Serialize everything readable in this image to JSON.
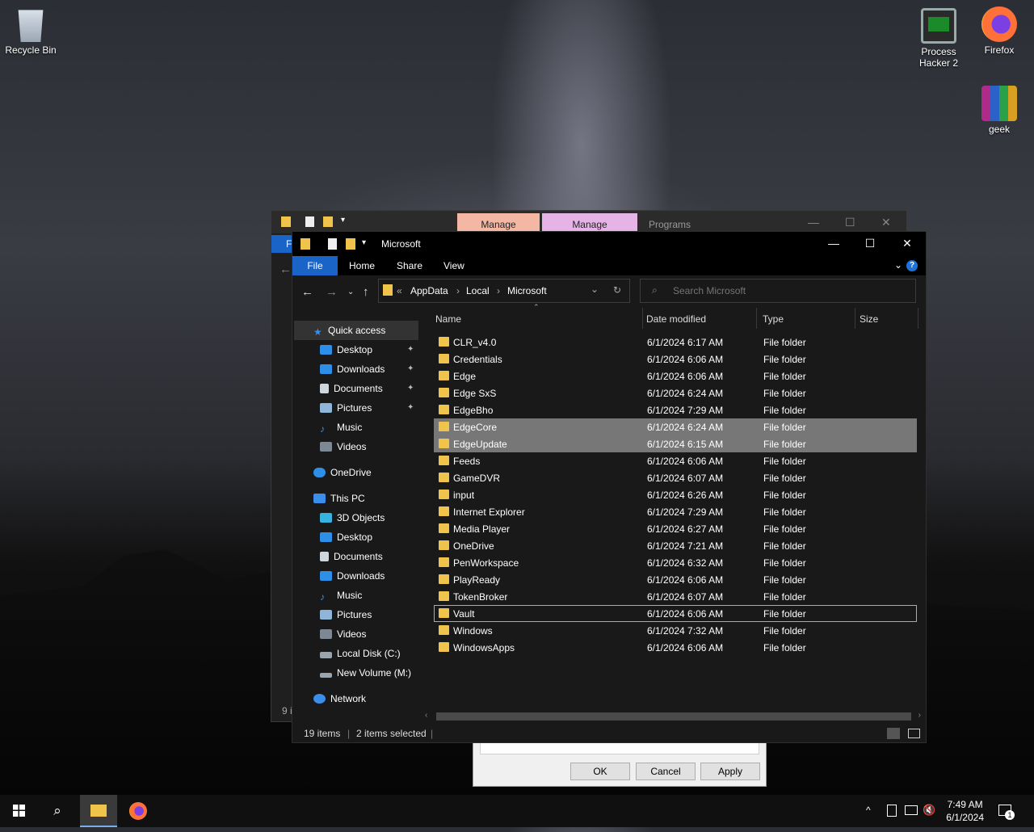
{
  "desktop": {
    "icons": [
      {
        "label": "Recycle Bin",
        "icon": "recycle-bin-icon"
      },
      {
        "label": "Process Hacker 2",
        "icon": "process-hacker-icon"
      },
      {
        "label": "Firefox",
        "icon": "firefox-icon"
      },
      {
        "label": "geek",
        "icon": "winrar-icon"
      }
    ]
  },
  "back_window": {
    "tabs": [
      "Manage",
      "Manage",
      "Programs"
    ],
    "tab_colors": [
      "#f4b7a3",
      "#e6b3e6"
    ],
    "status_fragment": "9 i",
    "file_fragment": "F"
  },
  "dialog": {
    "ok": "OK",
    "cancel": "Cancel",
    "apply": "Apply"
  },
  "explorer": {
    "title": "Microsoft",
    "ribbon": {
      "file": "File",
      "home": "Home",
      "share": "Share",
      "view": "View"
    },
    "ribbon_color": "#1a64c8",
    "address": {
      "overflow": "«",
      "crumbs": [
        "AppData",
        "Local",
        "Microsoft"
      ]
    },
    "search_placeholder": "Search Microsoft",
    "nav": {
      "quick_access": "Quick access",
      "quick_items": [
        "Desktop",
        "Downloads",
        "Documents",
        "Pictures",
        "Music",
        "Videos"
      ],
      "onedrive": "OneDrive",
      "this_pc": "This PC",
      "pc_items": [
        "3D Objects",
        "Desktop",
        "Documents",
        "Downloads",
        "Music",
        "Pictures",
        "Videos",
        "Local Disk (C:)",
        "New Volume (M:)"
      ],
      "network": "Network"
    },
    "columns": {
      "name": "Name",
      "date": "Date modified",
      "type": "Type",
      "size": "Size"
    },
    "files": [
      {
        "name": "CLR_v4.0",
        "date": "6/1/2024 6:17 AM",
        "type": "File folder"
      },
      {
        "name": "Credentials",
        "date": "6/1/2024 6:06 AM",
        "type": "File folder"
      },
      {
        "name": "Edge",
        "date": "6/1/2024 6:06 AM",
        "type": "File folder"
      },
      {
        "name": "Edge SxS",
        "date": "6/1/2024 6:24 AM",
        "type": "File folder"
      },
      {
        "name": "EdgeBho",
        "date": "6/1/2024 7:29 AM",
        "type": "File folder"
      },
      {
        "name": "EdgeCore",
        "date": "6/1/2024 6:24 AM",
        "type": "File folder",
        "selected": true
      },
      {
        "name": "EdgeUpdate",
        "date": "6/1/2024 6:15 AM",
        "type": "File folder",
        "selected": true
      },
      {
        "name": "Feeds",
        "date": "6/1/2024 6:06 AM",
        "type": "File folder"
      },
      {
        "name": "GameDVR",
        "date": "6/1/2024 6:07 AM",
        "type": "File folder"
      },
      {
        "name": "input",
        "date": "6/1/2024 6:26 AM",
        "type": "File folder"
      },
      {
        "name": "Internet Explorer",
        "date": "6/1/2024 7:29 AM",
        "type": "File folder"
      },
      {
        "name": "Media Player",
        "date": "6/1/2024 6:27 AM",
        "type": "File folder"
      },
      {
        "name": "OneDrive",
        "date": "6/1/2024 7:21 AM",
        "type": "File folder"
      },
      {
        "name": "PenWorkspace",
        "date": "6/1/2024 6:32 AM",
        "type": "File folder"
      },
      {
        "name": "PlayReady",
        "date": "6/1/2024 6:06 AM",
        "type": "File folder"
      },
      {
        "name": "TokenBroker",
        "date": "6/1/2024 6:07 AM",
        "type": "File folder"
      },
      {
        "name": "Vault",
        "date": "6/1/2024 6:06 AM",
        "type": "File folder",
        "focused": true
      },
      {
        "name": "Windows",
        "date": "6/1/2024 7:32 AM",
        "type": "File folder"
      },
      {
        "name": "WindowsApps",
        "date": "6/1/2024 6:06 AM",
        "type": "File folder"
      }
    ],
    "status": {
      "items": "19 items",
      "selected": "2 items selected"
    }
  },
  "taskbar": {
    "time": "7:49 AM",
    "date": "6/1/2024",
    "notification_count": "1"
  }
}
